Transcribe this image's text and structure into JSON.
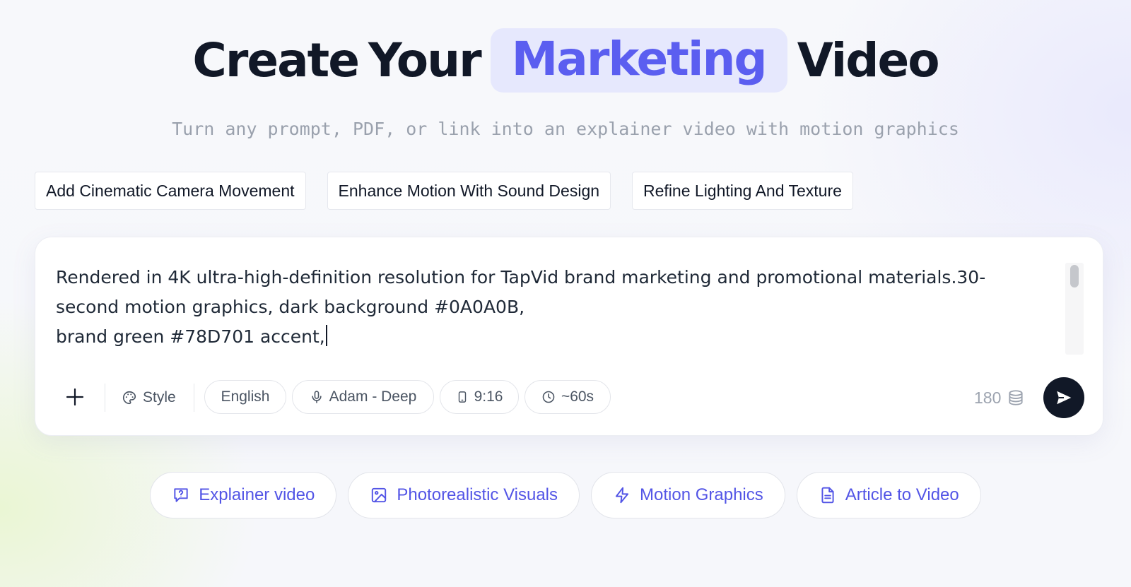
{
  "hero": {
    "title_part1": "Create",
    "title_part2": "Your",
    "title_highlight": "Marketing",
    "title_part3": "Video",
    "subtitle": "Turn any prompt, PDF, or link into an explainer video with motion graphics"
  },
  "suggestions": [
    {
      "label": "Add Cinematic Camera Movement"
    },
    {
      "label": "Enhance Motion With Sound Design"
    },
    {
      "label": "Refine Lighting And Texture"
    }
  ],
  "prompt": {
    "text": "Rendered in 4K ultra-high-definition resolution for TapVid brand marketing and promotional materials.30-second motion graphics, dark background #0A0A0B,\nbrand green #78D701 accent,"
  },
  "toolbar": {
    "style_label": "Style",
    "language": "English",
    "voice": "Adam - Deep",
    "aspect_ratio": "9:16",
    "duration": "~60s",
    "credits": "180"
  },
  "modes": [
    {
      "label": "Explainer video",
      "icon": "question-message-icon"
    },
    {
      "label": "Photorealistic Visuals",
      "icon": "image-icon"
    },
    {
      "label": "Motion Graphics",
      "icon": "lightning-icon"
    },
    {
      "label": "Article to Video",
      "icon": "document-icon"
    }
  ],
  "colors": {
    "accent": "#5B5EF0",
    "highlight_bg": "#E6E8FD",
    "send_button": "#111827",
    "mode_text": "#5355E6"
  }
}
